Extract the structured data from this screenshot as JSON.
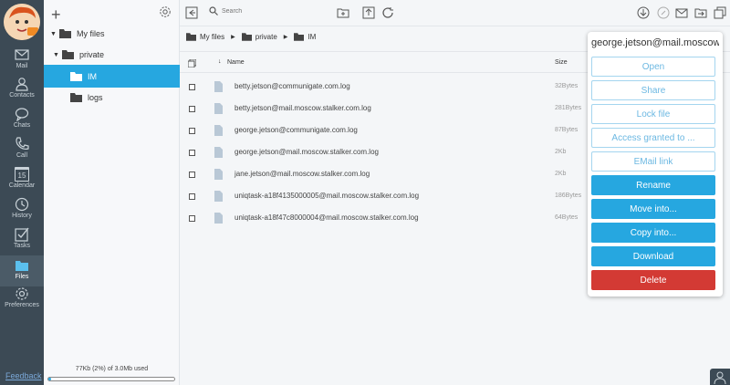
{
  "sidebar": {
    "items": [
      {
        "id": "mail",
        "label": "Mail"
      },
      {
        "id": "contacts",
        "label": "Contacts"
      },
      {
        "id": "chats",
        "label": "Chats"
      },
      {
        "id": "call",
        "label": "Call"
      },
      {
        "id": "calendar",
        "label": "Calendar",
        "day": "15"
      },
      {
        "id": "history",
        "label": "History"
      },
      {
        "id": "tasks",
        "label": "Tasks"
      },
      {
        "id": "files",
        "label": "Files"
      },
      {
        "id": "preferences",
        "label": "Preferences"
      }
    ],
    "active": "files",
    "feedback": "Feedback"
  },
  "tree": {
    "items": [
      {
        "label": "My files",
        "level": 0,
        "expanded": true
      },
      {
        "label": "private",
        "level": 1,
        "expanded": true
      },
      {
        "label": "IM",
        "level": 2,
        "selected": true
      },
      {
        "label": "logs",
        "level": 2
      }
    ],
    "quota_text": "77Kb (2%) of 3.0Mb used",
    "quota_fraction": 0.02
  },
  "toolbar": {
    "search_placeholder": "Search"
  },
  "breadcrumb": [
    "My files",
    "private",
    "IM"
  ],
  "table": {
    "col_name": "Name",
    "col_size": "Size",
    "rows": [
      {
        "name": "betty.jetson@communigate.com.log",
        "size": "32Bytes"
      },
      {
        "name": "betty.jetson@mail.moscow.stalker.com.log",
        "size": "281Bytes"
      },
      {
        "name": "george.jetson@communigate.com.log",
        "size": "87Bytes"
      },
      {
        "name": "george.jetson@mail.moscow.stalker.com.log",
        "size": "2Kb"
      },
      {
        "name": "jane.jetson@mail.moscow.stalker.com.log",
        "size": "2Kb"
      },
      {
        "name": "uniqtask-a18f4135000005@mail.moscow.stalker.com.log",
        "size": "186Bytes"
      },
      {
        "name": "uniqtask-a18f47c8000004@mail.moscow.stalker.com.log",
        "size": "64Bytes"
      }
    ]
  },
  "popup": {
    "title": "george.jetson@mail.moscow.stalker.com.log",
    "buttons": [
      {
        "label": "Open",
        "style": "outline"
      },
      {
        "label": "Share",
        "style": "outline"
      },
      {
        "label": "Lock file",
        "style": "outline"
      },
      {
        "label": "Access granted to ...",
        "style": "outline"
      },
      {
        "label": "EMail link",
        "style": "outline"
      },
      {
        "label": "Rename",
        "style": "solid"
      },
      {
        "label": "Move into...",
        "style": "solid"
      },
      {
        "label": "Copy into...",
        "style": "solid"
      },
      {
        "label": "Download",
        "style": "solid"
      },
      {
        "label": "Delete",
        "style": "danger"
      }
    ]
  },
  "colors": {
    "accent": "#26a7e0",
    "danger": "#d33a34",
    "sidebar_bg": "#3c4a55"
  }
}
